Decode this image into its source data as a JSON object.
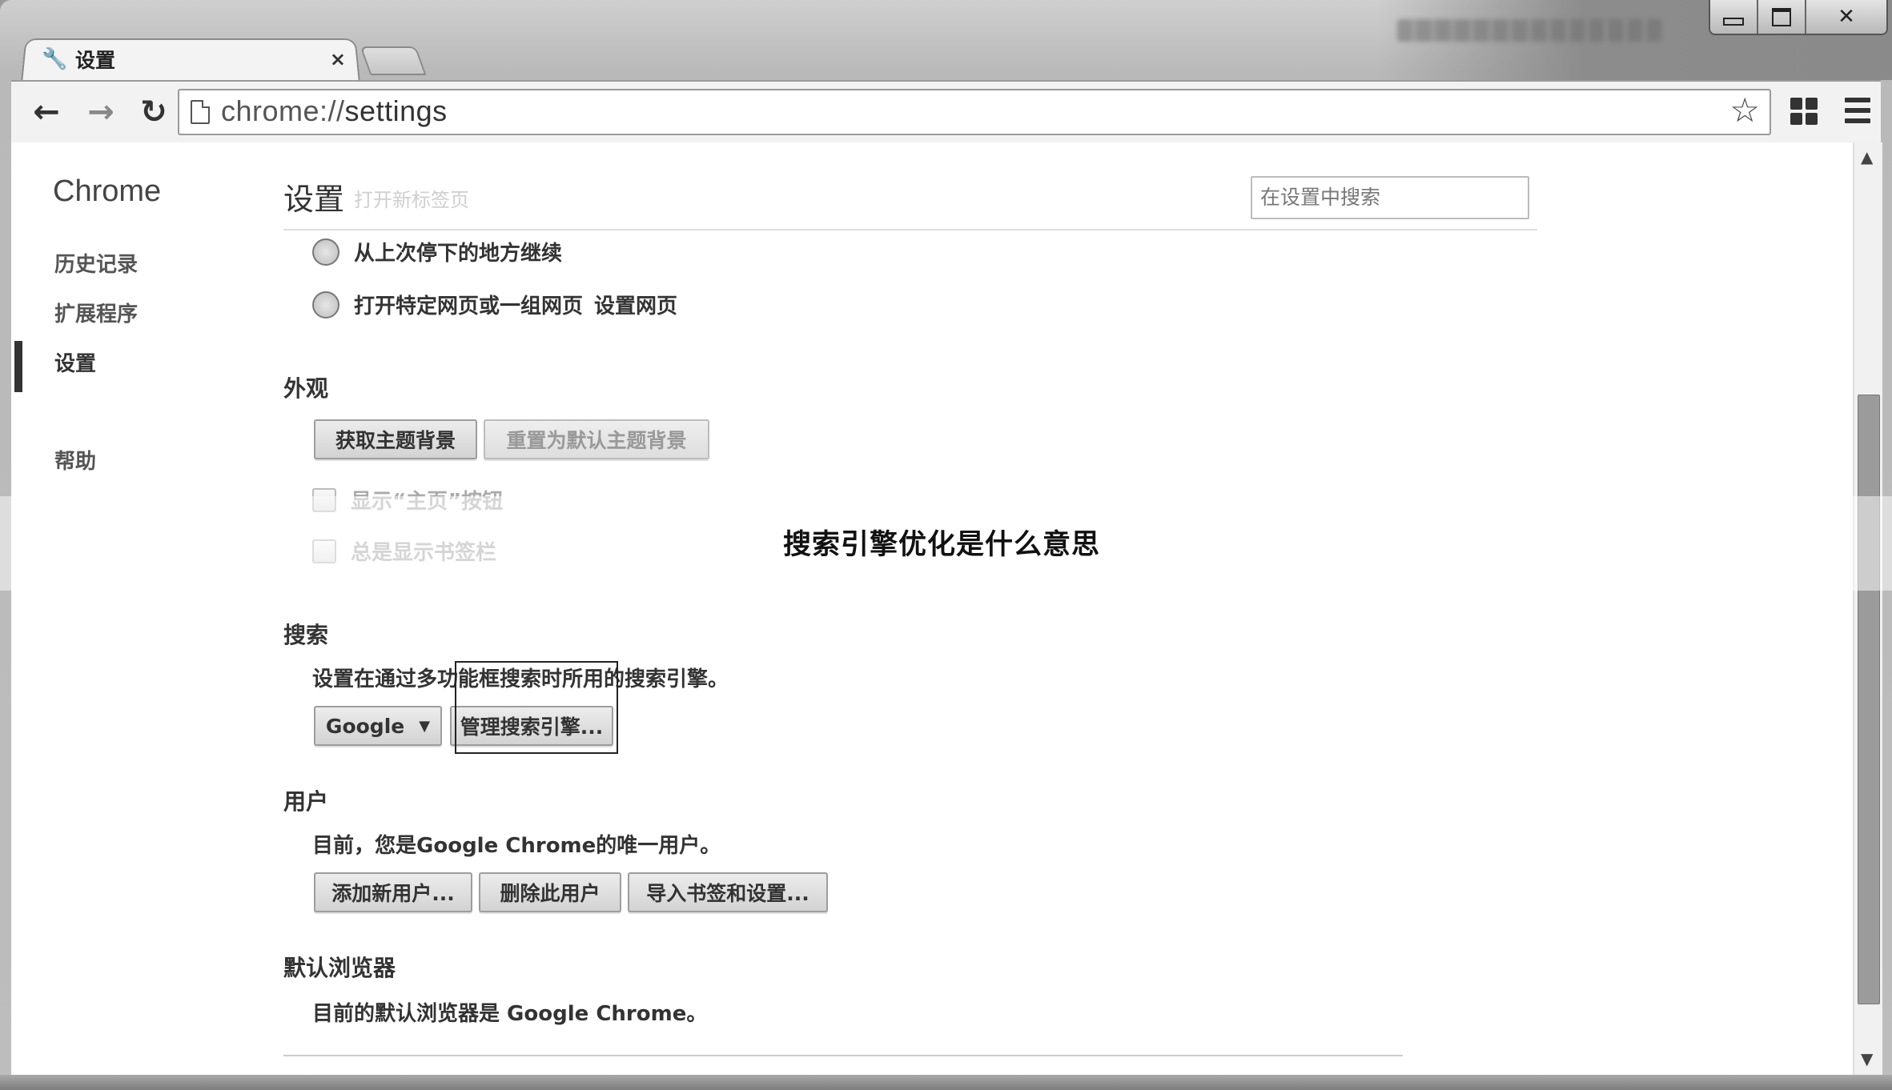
{
  "window": {
    "controls": {
      "minimize": "minimize",
      "maximize": "maximize",
      "close": "✕"
    }
  },
  "tab": {
    "title": "设置",
    "close": "×"
  },
  "toolbar": {
    "url_scheme": "chrome://",
    "url_path": "settings"
  },
  "sidebar": {
    "brand": "Chrome",
    "items": [
      {
        "label": "历史记录"
      },
      {
        "label": "扩展程序"
      },
      {
        "label": "设置"
      },
      {
        "label": "帮助"
      }
    ],
    "active": "设置"
  },
  "header": {
    "title": "设置",
    "subtitle": "打开新标签页",
    "search_placeholder": "在设置中搜索"
  },
  "startup": {
    "option_continue": "从上次停下的地方继续",
    "option_pages": "打开特定网页或一组网页",
    "set_pages_link": "设置网页"
  },
  "appearance": {
    "title": "外观",
    "get_themes": "获取主题背景",
    "reset_theme": "重置为默认主题背景",
    "show_home": "显示“主页”按钮",
    "show_bookmarks": "总是显示书签栏"
  },
  "search": {
    "title": "搜索",
    "description": "设置在通过多功能框搜索时所用的搜索引擎。",
    "engine_selected": "Google",
    "manage_engines": "管理搜索引擎..."
  },
  "users": {
    "title": "用户",
    "description": "目前，您是Google Chrome的唯一用户。",
    "add_user": "添加新用户...",
    "delete_user": "删除此用户",
    "import": "导入书签和设置..."
  },
  "default_browser": {
    "title": "默认浏览器",
    "description": "目前的默认浏览器是 Google Chrome。"
  },
  "overlay": {
    "caption": "搜索引擎优化是什么意思"
  }
}
